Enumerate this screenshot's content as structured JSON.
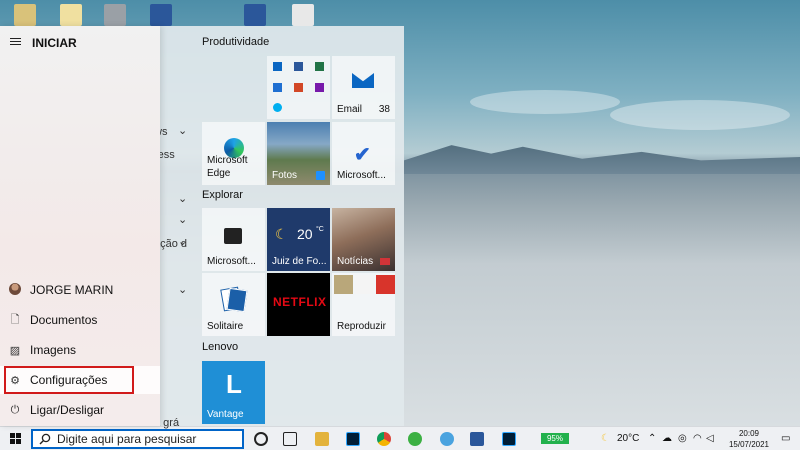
{
  "start_menu": {
    "title": "INICIAR",
    "user": "JORGE MARIN",
    "nav": {
      "documents": "Documentos",
      "images": "Imagens",
      "settings": "Configurações",
      "power": "Ligar/Desligar"
    },
    "peek_text": [
      "e",
      "ws",
      "ress",
      "ação d",
      "a grá"
    ]
  },
  "tiles": {
    "groups": {
      "productivity": "Produtividade",
      "explore": "Explorar",
      "lenovo": "Lenovo"
    },
    "email": {
      "label": "Email",
      "count": "38"
    },
    "edge": {
      "label_line1": "Microsoft",
      "label_line2": "Edge"
    },
    "photos": {
      "label": "Fotos"
    },
    "todo": {
      "label": "Microsoft..."
    },
    "store": {
      "label": "Microsoft..."
    },
    "weather": {
      "temp": "20",
      "unit": "°C",
      "label": "Juiz de Fo..."
    },
    "news": {
      "label": "Notícias"
    },
    "solitaire": {
      "label": "Solitaire"
    },
    "netflix": {
      "label": "NETFLIX"
    },
    "play": {
      "label": "Reproduzir"
    },
    "vantage": {
      "letter": "L",
      "label": "Vantage"
    }
  },
  "taskbar": {
    "search_placeholder": "Digite aqui para pesquisar",
    "battery": "95%",
    "temperature": "20°C",
    "time": "20:09",
    "date": "15/07/2021"
  },
  "colors": {
    "accent": "#0064c8",
    "highlight_border": "#d11a1a",
    "netflix_red": "#e50914",
    "vantage_blue": "#1f8fd6"
  }
}
